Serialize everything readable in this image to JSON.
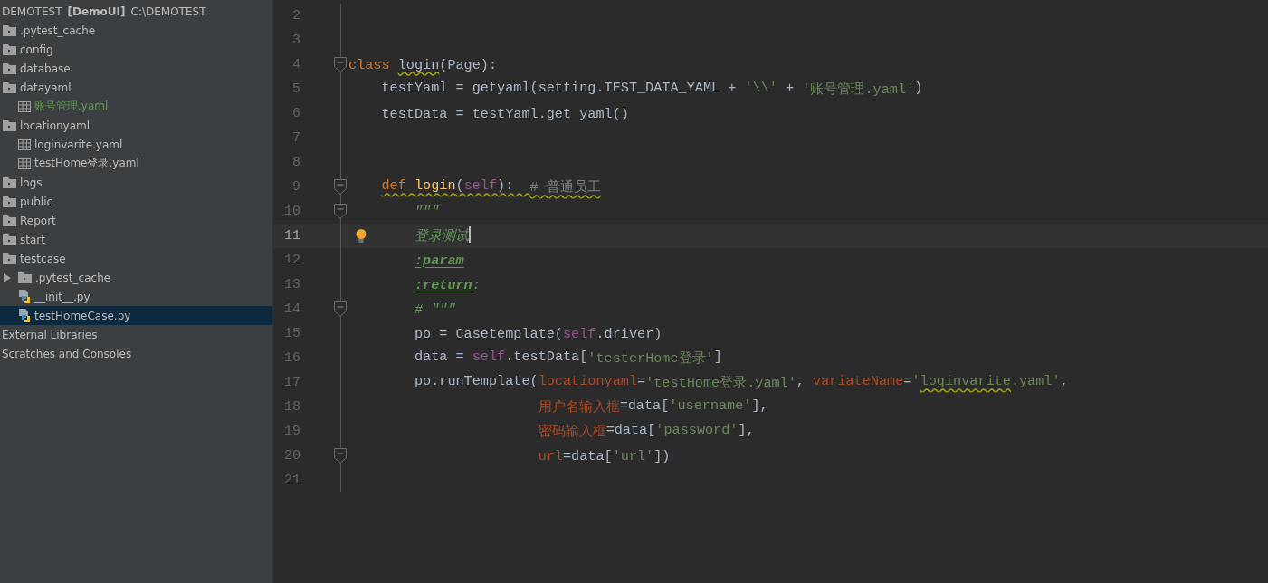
{
  "project": {
    "name": "DEMOTEST",
    "module": "[DemoUI]",
    "path": "C:\\DEMOTEST"
  },
  "tree": [
    {
      "label": ".pytest_cache",
      "kind": "folder",
      "selected": false
    },
    {
      "label": "config",
      "kind": "folder",
      "selected": false
    },
    {
      "label": "database",
      "kind": "folder",
      "selected": false
    },
    {
      "label": "datayaml",
      "kind": "folder",
      "selected": false,
      "children": [
        {
          "label": "账号管理.yaml",
          "kind": "yaml",
          "selected": false,
          "color": "#629755"
        }
      ]
    },
    {
      "label": "locationyaml",
      "kind": "folder",
      "selected": false,
      "children": [
        {
          "label": "loginvarite.yaml",
          "kind": "yaml",
          "selected": false
        },
        {
          "label": "testHome登录.yaml",
          "kind": "yaml",
          "selected": false
        }
      ]
    },
    {
      "label": "logs",
      "kind": "folder",
      "selected": false
    },
    {
      "label": "public",
      "kind": "folder",
      "selected": false
    },
    {
      "label": "Report",
      "kind": "folder",
      "selected": false
    },
    {
      "label": "start",
      "kind": "folder",
      "selected": false
    },
    {
      "label": "testcase",
      "kind": "folder",
      "selected": false,
      "children": [
        {
          "label": ".pytest_cache",
          "kind": "folder",
          "selected": false,
          "expanded": false
        },
        {
          "label": "__init__.py",
          "kind": "python",
          "selected": false
        },
        {
          "label": "testHomeCase.py",
          "kind": "python",
          "selected": true
        }
      ]
    },
    {
      "label": "External Libraries",
      "kind": "plain",
      "selected": false
    },
    {
      "label": "Scratches and Consoles",
      "kind": "plain",
      "selected": false
    }
  ],
  "editor": {
    "lines": [
      {
        "number": "2",
        "current": false
      },
      {
        "number": "3",
        "current": false
      },
      {
        "number": "4",
        "current": false,
        "fold": true,
        "tokens": [
          {
            "text": "class ",
            "kind": "keyword"
          },
          {
            "text": "login",
            "kind": "plain",
            "warn": true
          },
          {
            "text": "(Page):",
            "kind": "plain"
          }
        ]
      },
      {
        "number": "5",
        "current": false,
        "tokens": [
          {
            "text": "    testYaml = getyaml(setting.TEST_DATA_YAML + ",
            "kind": "plain"
          },
          {
            "text": "'\\\\'",
            "kind": "string"
          },
          {
            "text": " + ",
            "kind": "plain"
          },
          {
            "text": "'账号管理.yaml'",
            "kind": "string"
          },
          {
            "text": ")",
            "kind": "plain"
          }
        ]
      },
      {
        "number": "6",
        "current": false,
        "tokens": [
          {
            "text": "    testData = testYaml.get_yaml()",
            "kind": "plain"
          }
        ]
      },
      {
        "number": "7",
        "current": false
      },
      {
        "number": "8",
        "current": false
      },
      {
        "number": "9",
        "current": false,
        "fold": true,
        "tokens": [
          {
            "text": "    def ",
            "kind": "keyword",
            "warn": true
          },
          {
            "text": "login",
            "kind": "function",
            "warn": true
          },
          {
            "text": "(",
            "kind": "plain",
            "warn": true
          },
          {
            "text": "self",
            "kind": "self",
            "warn": true
          },
          {
            "text": "):  ",
            "kind": "plain",
            "warn": true
          },
          {
            "text": "# 普通员工",
            "kind": "comment",
            "warn": true
          }
        ]
      },
      {
        "number": "10",
        "current": false,
        "fold": true,
        "tokens": [
          {
            "text": "        \"\"\"",
            "kind": "docstring"
          }
        ]
      },
      {
        "number": "11",
        "current": true,
        "bulb": true,
        "tokens": [
          {
            "text": "        登录测试",
            "kind": "docstring"
          }
        ]
      },
      {
        "number": "12",
        "current": false,
        "tokens": [
          {
            "text": "        :param",
            "kind": "doctag"
          }
        ]
      },
      {
        "number": "13",
        "current": false,
        "tokens": [
          {
            "text": "        :return",
            "kind": "doctag"
          },
          {
            "text": ":",
            "kind": "docstring"
          }
        ]
      },
      {
        "number": "14",
        "current": false,
        "fold": true,
        "tokens": [
          {
            "text": "        # \"\"\"",
            "kind": "docstring"
          }
        ]
      },
      {
        "number": "15",
        "current": false,
        "tokens": [
          {
            "text": "        po = Casetemplate(",
            "kind": "plain"
          },
          {
            "text": "self",
            "kind": "self"
          },
          {
            "text": ".driver)",
            "kind": "plain"
          }
        ]
      },
      {
        "number": "16",
        "current": false,
        "tokens": [
          {
            "text": "        data = ",
            "kind": "plain"
          },
          {
            "text": "self",
            "kind": "self"
          },
          {
            "text": ".testData[",
            "kind": "plain"
          },
          {
            "text": "'testerHome登录'",
            "kind": "string"
          },
          {
            "text": "]",
            "kind": "plain"
          }
        ]
      },
      {
        "number": "17",
        "current": false,
        "tokens": [
          {
            "text": "        po.runTemplate(",
            "kind": "plain"
          },
          {
            "text": "locationyaml",
            "kind": "param"
          },
          {
            "text": "=",
            "kind": "plain"
          },
          {
            "text": "'testHome登录.yaml'",
            "kind": "string"
          },
          {
            "text": ", ",
            "kind": "plain"
          },
          {
            "text": "variateName",
            "kind": "param"
          },
          {
            "text": "=",
            "kind": "plain"
          },
          {
            "text": "'",
            "kind": "string"
          },
          {
            "text": "loginvarite",
            "kind": "string",
            "warn": true
          },
          {
            "text": ".yaml'",
            "kind": "string"
          },
          {
            "text": ",",
            "kind": "plain"
          }
        ]
      },
      {
        "number": "18",
        "current": false,
        "tokens": [
          {
            "text": "                       用户名输入框",
            "kind": "param"
          },
          {
            "text": "=data[",
            "kind": "plain"
          },
          {
            "text": "'username'",
            "kind": "string"
          },
          {
            "text": "],",
            "kind": "plain"
          }
        ]
      },
      {
        "number": "19",
        "current": false,
        "tokens": [
          {
            "text": "                       密码输入框",
            "kind": "param"
          },
          {
            "text": "=data[",
            "kind": "plain"
          },
          {
            "text": "'password'",
            "kind": "string"
          },
          {
            "text": "],",
            "kind": "plain"
          }
        ]
      },
      {
        "number": "20",
        "current": false,
        "fold": true,
        "tokens": [
          {
            "text": "                       url",
            "kind": "param"
          },
          {
            "text": "=data[",
            "kind": "plain"
          },
          {
            "text": "'url'",
            "kind": "string"
          },
          {
            "text": "])",
            "kind": "plain"
          }
        ]
      },
      {
        "number": "21",
        "current": false
      }
    ]
  }
}
